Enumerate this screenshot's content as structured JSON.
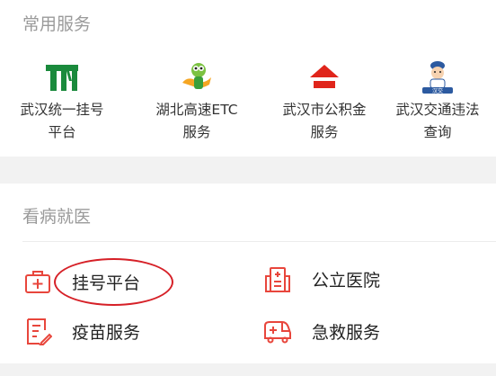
{
  "sections": {
    "common": {
      "title": "常用服务",
      "services": [
        {
          "line1": "武汉统一挂号",
          "line2": "平台",
          "icon": "tm-logo-icon"
        },
        {
          "line1": "湖北高速ETC",
          "line2": "服务",
          "icon": "etc-mascot-icon"
        },
        {
          "line1": "武汉市公积金",
          "line2": "服务",
          "icon": "housing-fund-house-icon"
        },
        {
          "line1": "武汉交通违法",
          "line2": "查询",
          "icon": "traffic-police-icon"
        }
      ]
    },
    "medical": {
      "title": "看病就医",
      "items": [
        {
          "label": "挂号平台",
          "icon": "medical-kit-icon"
        },
        {
          "label": "公立医院",
          "icon": "hospital-icon"
        },
        {
          "label": "疫苗服务",
          "icon": "vaccine-clipboard-icon"
        },
        {
          "label": "急救服务",
          "icon": "ambulance-icon"
        }
      ]
    }
  },
  "logo_text": {
    "tm": "TM",
    "traffic": "汉交"
  },
  "colors": {
    "accent_red": "#e8463c",
    "tm_green": "#1a8a3c",
    "highlight_circle": "#d62027"
  }
}
